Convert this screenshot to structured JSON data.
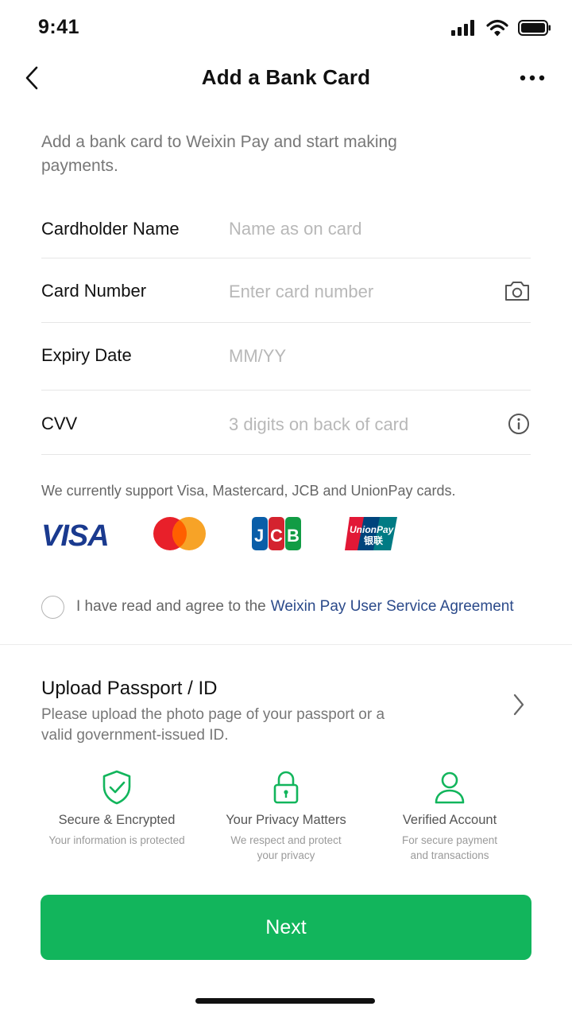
{
  "status_bar": {
    "time": "9:41"
  },
  "header": {
    "title": "Add a Bank Card"
  },
  "intro": "Add a bank card to Weixin Pay and start making payments.",
  "form": {
    "cardholder": {
      "label": "Cardholder Name",
      "placeholder": "Name as on card"
    },
    "card_number": {
      "label": "Card Number",
      "placeholder": "Enter card number"
    },
    "expiry": {
      "label": "Expiry Date",
      "placeholder": "MM/YY"
    },
    "cvv": {
      "label": "CVV",
      "placeholder": "3 digits on back of card"
    }
  },
  "support": {
    "text": "We currently support Visa, Mastercard, JCB and UnionPay cards.",
    "brands": [
      "visa-logo",
      "mastercard-logo",
      "jcb-logo",
      "unionpay-logo"
    ]
  },
  "agreement": {
    "text": "I have read and agree to the",
    "link": "Weixin Pay User Service Agreement",
    "checked": false
  },
  "upload": {
    "title": "Upload Passport / ID",
    "description": "Please upload the photo page of your passport or a valid government-issued ID."
  },
  "features": [
    {
      "icon": "shield-check-icon",
      "title": "Secure & Encrypted",
      "subtitle": "Your information is protected"
    },
    {
      "icon": "lock-icon",
      "title": "Your Privacy Matters",
      "subtitle": "We respect and protect\nyour privacy"
    },
    {
      "icon": "user-icon",
      "title": "Verified Account",
      "subtitle": "For secure payment\nand transactions"
    }
  ],
  "actions": {
    "next": "Next"
  },
  "colors": {
    "accent": "#12b55c",
    "link": "#2b4a8a",
    "icon_green": "#12b55c"
  }
}
